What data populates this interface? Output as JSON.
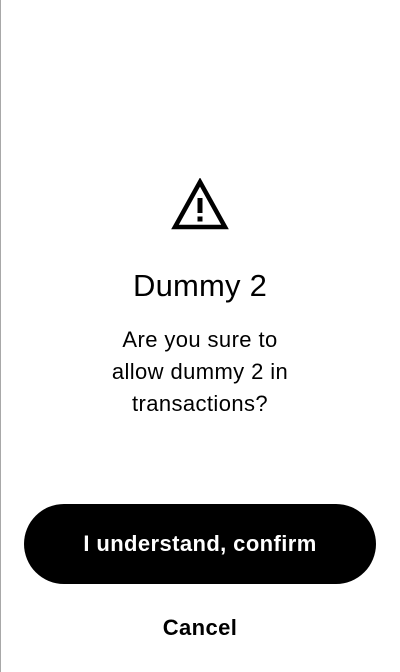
{
  "dialog": {
    "icon": "warning-triangle-icon",
    "title": "Dummy 2",
    "message": "Are you sure to allow dummy 2 in transactions?",
    "confirm_label": "I understand, confirm",
    "cancel_label": "Cancel"
  },
  "colors": {
    "background": "#ffffff",
    "text": "#000000",
    "button_bg": "#000000",
    "button_text": "#ffffff"
  }
}
